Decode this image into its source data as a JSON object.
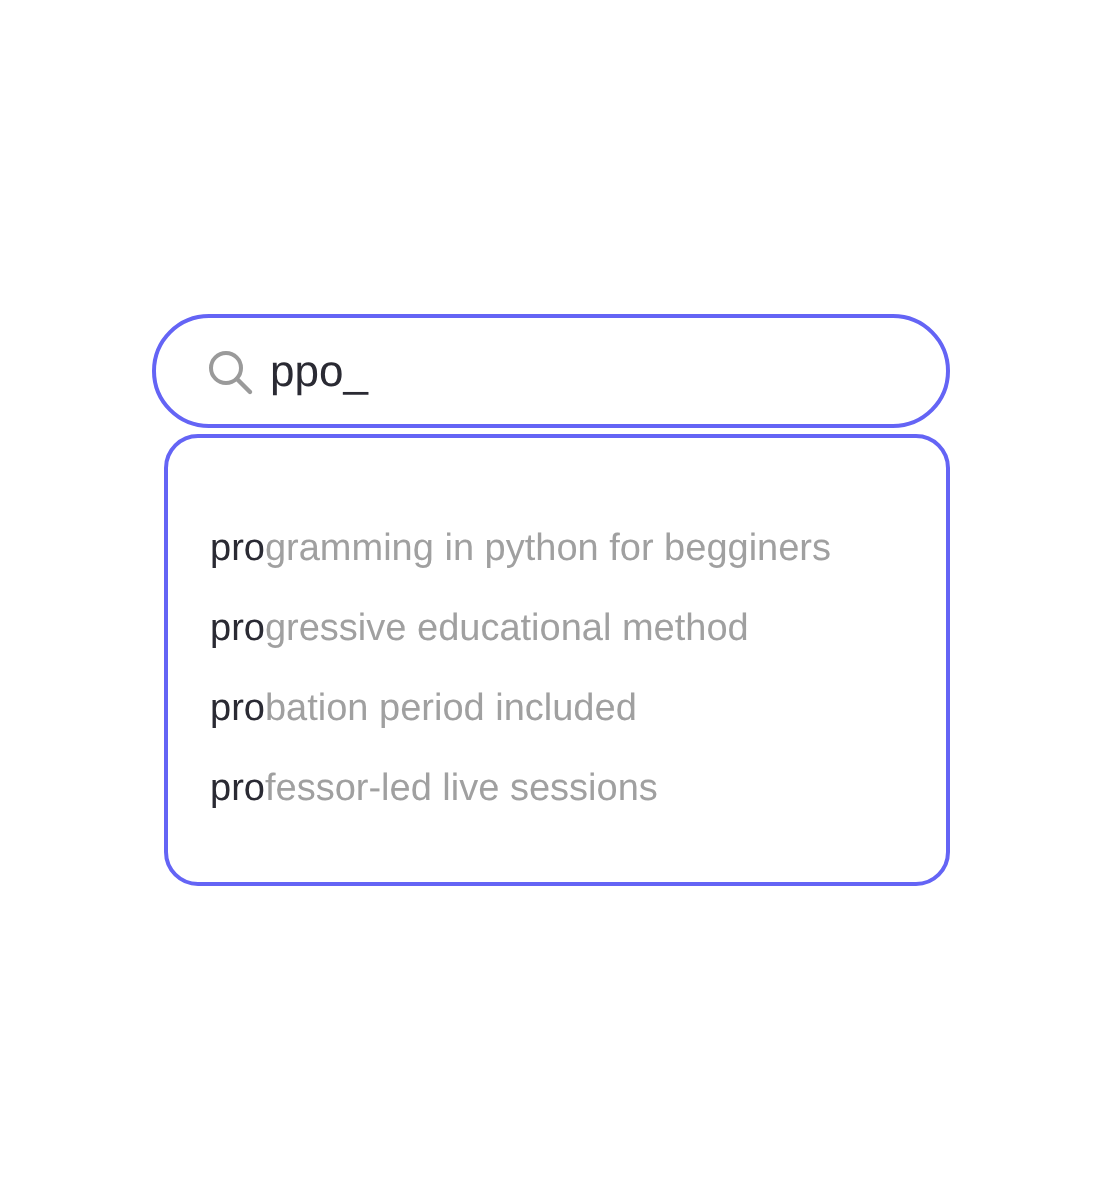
{
  "search": {
    "value": "ppo_"
  },
  "suggestions": [
    {
      "match": "pro",
      "rest": "gramming in python for begginers"
    },
    {
      "match": "pro",
      "rest": "gressive educational method"
    },
    {
      "match": "pro",
      "rest": "bation period included"
    },
    {
      "match": "pro",
      "rest": "fessor-led live sessions"
    }
  ]
}
